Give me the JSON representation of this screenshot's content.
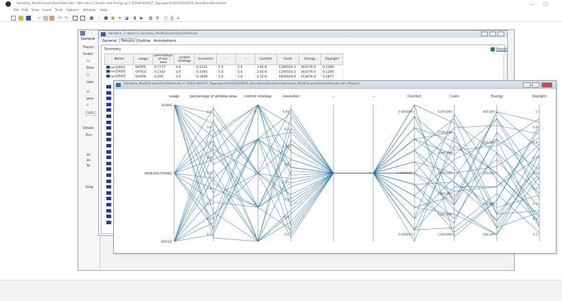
{
  "app": {
    "title": "Swissbau_Mod01b-parmRunVisResults - IDA Indoor Climate and Energy @ C:\\EQUA-NAS\\07_TagungenArtikel\\2020016_SwissBau\\Simulation",
    "window_controls": [
      "—",
      "□"
    ]
  },
  "menu": [
    "File",
    "Edit",
    "View",
    "Insert",
    "Tools",
    "Options",
    "Window",
    "Help"
  ],
  "left_panel": {
    "tab": "General",
    "project_label": "Project",
    "global_label": "Global",
    "items": [
      "Lo",
      "Base",
      "Cl",
      "Upte",
      "W",
      "geoc",
      "H",
      "rvalu"
    ],
    "details_label": "Details",
    "details_item": "Zon",
    "checks": [
      "Zo",
      "Zo",
      "To"
    ],
    "diag_label": "Diag"
  },
  "param_window": {
    "title": "ParmRun_1 object in Swissbau_Mod01b-parmRunVisResults",
    "tabs": [
      "General",
      "Results",
      "Outline",
      "Annotations"
    ],
    "active_tab": "Results",
    "summary_label": "Summary",
    "report_link": "Report",
    "columns": [
      "Name",
      "usage",
      "percentage of win. area",
      "control strategy",
      "insulation",
      "--",
      "--",
      "Comfort",
      "Costs",
      "Energy",
      "Daylight"
    ],
    "rows": [
      [
        "run10001",
        "SHOPS",
        "0.7777",
        "4.0",
        "0.2221",
        "5.0",
        "5.0",
        "3.0E-6",
        "1240554.3",
        "361076.0",
        "0.1209"
      ],
      [
        "run10002",
        "OFFICE",
        "0.1432",
        "5.0",
        "0.3365",
        "5.0",
        "5.0",
        "3.0E-6",
        "1240554.3",
        "361076.0",
        "0.1209"
      ],
      [
        "run10003",
        "SHOPS",
        "0.295",
        "2.0",
        "0.1048",
        "5.0",
        "5.0",
        "4.1E-6",
        "1659104.9",
        "212874.9",
        "0.2877"
      ]
    ]
  },
  "report_window": {
    "title": "Swissbau_Mod01b-parmRunVisResults: C:\\EQUA-NAS\\07_TagungenArtikel\\2020016_SwissBau\\Simulation\\Swissbau_Mod01b-parmRunVisResults.idm (Report)"
  },
  "chart_data": {
    "type": "parallel-coordinates",
    "axes": [
      {
        "name": "usage",
        "categories": [
          "SHOPS",
          "MANUFACTURING",
          "OFFICE"
        ]
      },
      {
        "name": "percentage of window area",
        "ticks": [
          "0.9",
          "0.8",
          "0.7",
          "0.6",
          "0.5",
          "0.4",
          "0.3",
          "0.2",
          "0.1"
        ]
      },
      {
        "name": "control strategy",
        "ticks": [
          "5",
          "4",
          "3",
          "2",
          "1"
        ]
      },
      {
        "name": "insulation",
        "ticks": [
          "0.45",
          "0.4",
          "0.35",
          "0.3",
          "0.25",
          "0.2",
          "0.15",
          "0.1"
        ]
      },
      {
        "name": "--",
        "ticks": [
          "5"
        ]
      },
      {
        "name": "--",
        "ticks": [
          "5"
        ]
      },
      {
        "name": "Comfort",
        "ticks": [
          "0.000004",
          "0.0000035",
          "0.000003"
        ]
      },
      {
        "name": "Costs",
        "ticks": [
          "4,000,000",
          "3,500,000",
          "3,000,000",
          "2,500,000",
          "2,000,000",
          "1,500,000",
          "1,000,000"
        ]
      },
      {
        "name": "Energy",
        "ticks": [
          "400,000",
          "350,000",
          "300,000",
          "250,000",
          "200,000"
        ]
      },
      {
        "name": "Daylight",
        "ticks": [
          "1",
          "0.9",
          "0.8",
          "0.7",
          "0.6",
          "0.5",
          "0.4",
          "0.3",
          "0.2"
        ]
      }
    ],
    "line_color": "#2f7aa8",
    "lines": [
      [
        0,
        0.62,
        2,
        0.25,
        5,
        5,
        3.8e-06,
        2300000,
        230000,
        0.75
      ],
      [
        0,
        0.16,
        4,
        0.29,
        5,
        5,
        4.1e-06,
        1800000,
        350000,
        0.62
      ],
      [
        0,
        0.79,
        3,
        0.35,
        5,
        5,
        3.1e-06,
        3100000,
        300000,
        0.35
      ],
      [
        0,
        0.27,
        1,
        0.18,
        5,
        5,
        3.5e-06,
        1200000,
        260000,
        0.88
      ],
      [
        0,
        0.71,
        5,
        0.4,
        5,
        5,
        3.9e-06,
        2900000,
        380000,
        0.45
      ],
      [
        0,
        0.44,
        2,
        0.13,
        5,
        5,
        3.3e-06,
        1600000,
        210000,
        0.58
      ],
      [
        0,
        0.55,
        4,
        0.31,
        5,
        5,
        4.2e-06,
        3600000,
        330000,
        0.28
      ],
      [
        0,
        0.85,
        3,
        0.22,
        5,
        5,
        3.6e-06,
        2100000,
        280000,
        0.7
      ],
      [
        0,
        0.12,
        1,
        0.42,
        5,
        5,
        3e-06,
        3300000,
        240000,
        0.38
      ],
      [
        0,
        0.38,
        5,
        0.27,
        5,
        5,
        3.7e-06,
        2500000,
        310000,
        0.81
      ],
      [
        1,
        0.64,
        3,
        0.2,
        5,
        5,
        3.4e-06,
        1400000,
        360000,
        0.52
      ],
      [
        1,
        0.23,
        5,
        0.33,
        5,
        5,
        4e-06,
        2700000,
        220000,
        0.66
      ],
      [
        1,
        0.76,
        1,
        0.15,
        5,
        5,
        3.2e-06,
        3800000,
        290000,
        0.31
      ],
      [
        1,
        0.47,
        4,
        0.38,
        5,
        5,
        3.8e-06,
        1900000,
        390000,
        0.74
      ],
      [
        1,
        0.33,
        2,
        0.24,
        5,
        5,
        3.5e-06,
        2300000,
        250000,
        0.47
      ],
      [
        1,
        0.88,
        3,
        0.11,
        5,
        5,
        4.1e-06,
        3000000,
        340000,
        0.92
      ],
      [
        1,
        0.18,
        5,
        0.29,
        5,
        5,
        3.1e-06,
        1300000,
        270000,
        0.25
      ],
      [
        1,
        0.58,
        4,
        0.43,
        5,
        5,
        3.9e-06,
        2600000,
        230000,
        0.6
      ],
      [
        1,
        0.69,
        1,
        0.17,
        5,
        5,
        3.6e-06,
        3500000,
        370000,
        0.83
      ],
      [
        1,
        0.41,
        2,
        0.36,
        5,
        5,
        3.3e-06,
        2000000,
        320000,
        0.4
      ],
      [
        2,
        0.26,
        3,
        0.26,
        5,
        5,
        3.7e-06,
        1700000,
        210000,
        0.71
      ],
      [
        2,
        0.73,
        5,
        0.14,
        5,
        5,
        4e-06,
        3200000,
        300000,
        0.34
      ],
      [
        2,
        0.52,
        1,
        0.39,
        5,
        5,
        3.2e-06,
        2400000,
        380000,
        0.56
      ],
      [
        2,
        0.14,
        4,
        0.21,
        5,
        5,
        4.2e-06,
        1100000,
        260000,
        0.86
      ],
      [
        2,
        0.81,
        2,
        0.31,
        5,
        5,
        3.4e-06,
        2800000,
        350000,
        0.29
      ],
      [
        2,
        0.36,
        3,
        0.44,
        5,
        5,
        3.8e-06,
        3700000,
        240000,
        0.64
      ],
      [
        2,
        0.61,
        5,
        0.19,
        5,
        5,
        3.5e-06,
        1500000,
        330000,
        0.48
      ],
      [
        2,
        0.47,
        1,
        0.28,
        5,
        5,
        3.1e-06,
        2200000,
        280000,
        0.77
      ],
      [
        2,
        0.21,
        4,
        0.12,
        5,
        5,
        3.9e-06,
        3400000,
        220000,
        0.37
      ],
      [
        2,
        0.67,
        2,
        0.35,
        5,
        5,
        3.6e-06,
        1800000,
        390000,
        0.9
      ]
    ]
  }
}
